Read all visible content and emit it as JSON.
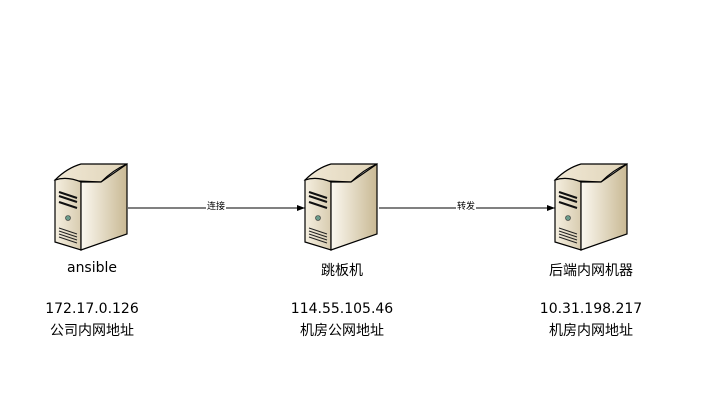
{
  "nodes": [
    {
      "name": "ansible",
      "ip": "172.17.0.126",
      "desc": "公司内网地址"
    },
    {
      "name": "跳板机",
      "ip": "114.55.105.46",
      "desc": "机房公网地址"
    },
    {
      "name": "后端内网机器",
      "ip": "10.31.198.217",
      "desc": "机房内网地址"
    }
  ],
  "edges": [
    {
      "label": "连接",
      "from": "ansible",
      "to": "跳板机"
    },
    {
      "label": "转发",
      "from": "跳板机",
      "to": "后端内网机器"
    }
  ],
  "icon": "server-tower-icon"
}
